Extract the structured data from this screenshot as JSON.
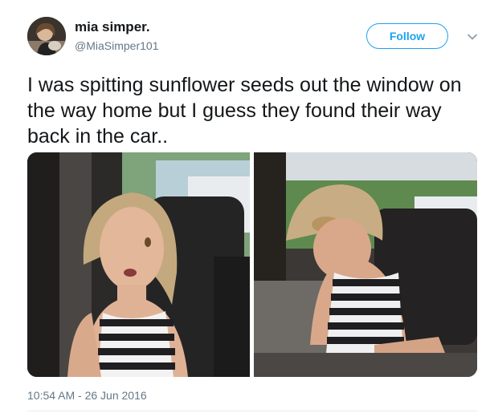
{
  "user": {
    "display_name": "mia simper.",
    "handle": "@MiaSimper101"
  },
  "follow_button": {
    "label": "Follow"
  },
  "tweet": {
    "text": "I was spitting sunflower seeds out the window on the way home but I guess they found their way back in the car..",
    "timestamp": "10:54 AM - 26 Jun 2016"
  },
  "colors": {
    "accent": "#1da1f2",
    "secondary_text": "#657786",
    "primary_text": "#14171a"
  },
  "icons": {
    "more_menu": "chevron-down-icon"
  }
}
